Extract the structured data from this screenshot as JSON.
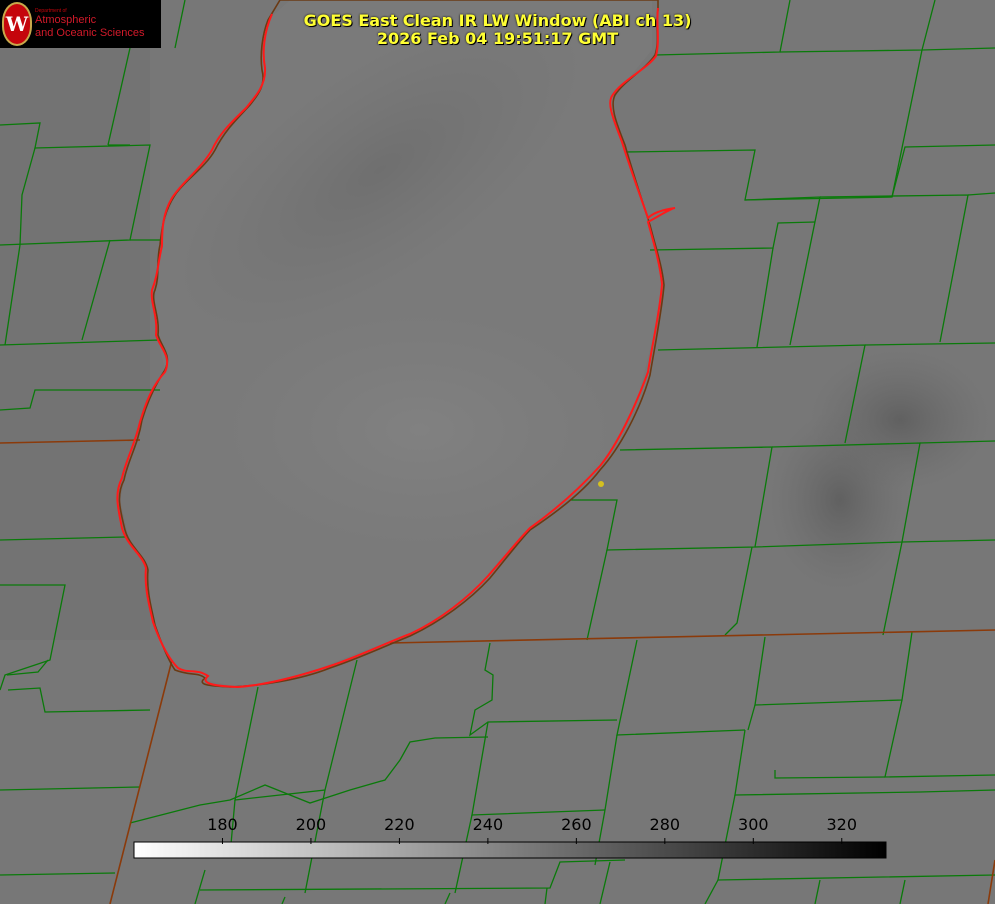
{
  "title": {
    "line1": "GOES East Clean IR LW Window (ABI ch 13)",
    "line2": "2026 Feb 04 19:51:17 GMT"
  },
  "logo": {
    "dept": "Department of",
    "line1": "Atmospheric",
    "line2": "and Oceanic Sciences",
    "seal_letter": "W"
  },
  "colorbar": {
    "min": 160,
    "max": 330,
    "ticks": [
      180,
      200,
      220,
      240,
      260,
      280,
      300,
      320
    ],
    "low_color": "#ffffff",
    "high_color": "#000000"
  },
  "colors": {
    "county_lines": "#0a7a0a",
    "state_lines": "#8b3a0a",
    "lake_outline": "#ff1a1a",
    "title_text": "#ffff33",
    "marker": "#d4c020"
  }
}
